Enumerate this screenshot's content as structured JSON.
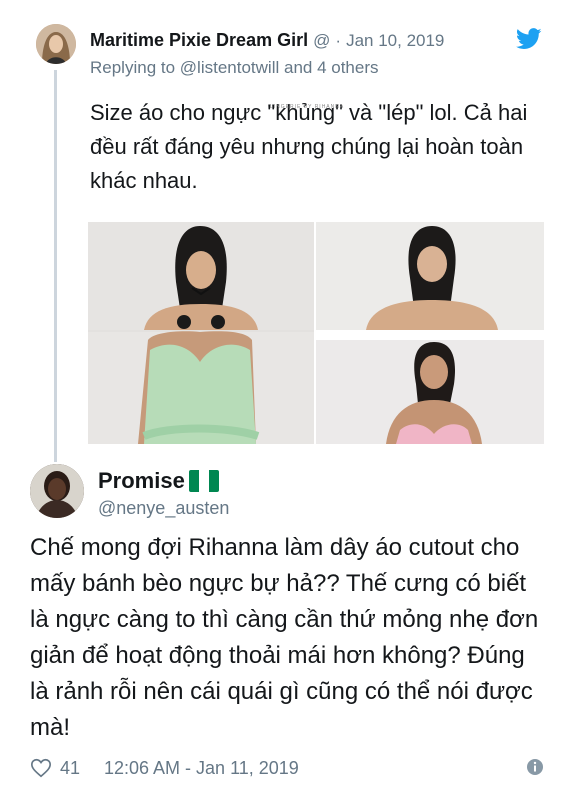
{
  "tweet1": {
    "name": "Maritime Pixie Dream Girl",
    "handle": "@",
    "separator": "·",
    "date": "Jan 10, 2019",
    "reply_prefix": "Replying to",
    "reply_to": "@listentotwill",
    "reply_suffix": "and 4 others",
    "text": "Size áo cho ngực \"khủng\" và \"lép\" lol. Cả hai đều rất đáng yêu nhưng chúng lại hoàn toàn khác nhau.",
    "media_count": 3
  },
  "tweet2": {
    "name": "Promise",
    "flag": "nigeria-flag-icon",
    "handle": "@nenye_austen",
    "text": "Chế mong đợi Rihanna làm dây áo cutout cho mấy bánh bèo ngực bự hả?? Thế cưng có biết là ngực càng to thì càng cần thứ mỏng nhẹ đơn giản để hoạt động thoải mái hơn không? Đúng là rảnh rỗi nên cái quái gì cũng có thể nói được mà!",
    "likes": "41",
    "timestamp": "12:06 AM - Jan 11, 2019"
  },
  "photo_caption": "LINGERIE BY RIHANNA",
  "colors": {
    "text": "#14171a",
    "secondary": "#657786",
    "twitter_blue": "#1da1f2",
    "thread_line": "#cdd5dd",
    "flag_green": "#008751"
  },
  "icons": [
    "twitter-bird-icon",
    "heart-icon",
    "info-icon",
    "nigeria-flag-icon"
  ]
}
